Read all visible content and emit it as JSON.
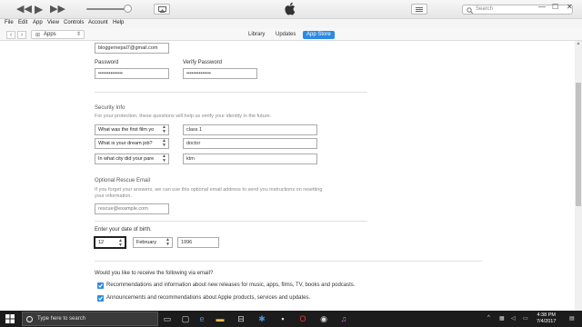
{
  "menu": [
    "File",
    "Edit",
    "App",
    "View",
    "Controls",
    "Account",
    "Help"
  ],
  "toolbar": {
    "search_placeholder": "Search"
  },
  "nav": {
    "media_kind": "Apps",
    "tabs": [
      "Library",
      "Updates",
      "App Store"
    ],
    "active_tab": "App Store"
  },
  "form": {
    "email": "bloggernepal7@gmail.com",
    "password_label": "Password",
    "password_value": "••••••••••••••",
    "verify_label": "Verify Password",
    "verify_value": "••••••••••••••",
    "security_heading": "Security Info",
    "security_desc": "For your protection, these questions will help us verify your identity in the future.",
    "questions": [
      {
        "question": "What was the first film yo",
        "answer": "class 1"
      },
      {
        "question": "What is your dream job?",
        "answer": "doctor"
      },
      {
        "question": "In what city did your pare",
        "answer": "ktm"
      }
    ],
    "rescue_heading": "Optional Rescue Email",
    "rescue_desc_1": "If you forget your answers, we can use this optional email address to send you instructions on resetting",
    "rescue_desc_2": "your information.",
    "rescue_placeholder": "rescue@example.com",
    "dob_label": "Enter your date of birth.",
    "dob_day": "12",
    "dob_month": "February",
    "dob_year": "1996",
    "email_pref_label": "Would you like to receive the following via email?",
    "pref_1": "Recommendations and information about new releases for music, apps, films, TV, books and podcasts.",
    "pref_2": "Announcements and recommendations about Apple products, services and updates.",
    "pref_1_checked": true,
    "pref_2_checked": true
  },
  "taskbar": {
    "search_text": "Type here to search",
    "time": "4:38 PM",
    "date": "7/4/2017"
  },
  "colors": {
    "accent": "#2b8ae2",
    "taskbar": "#1c1c1c"
  }
}
